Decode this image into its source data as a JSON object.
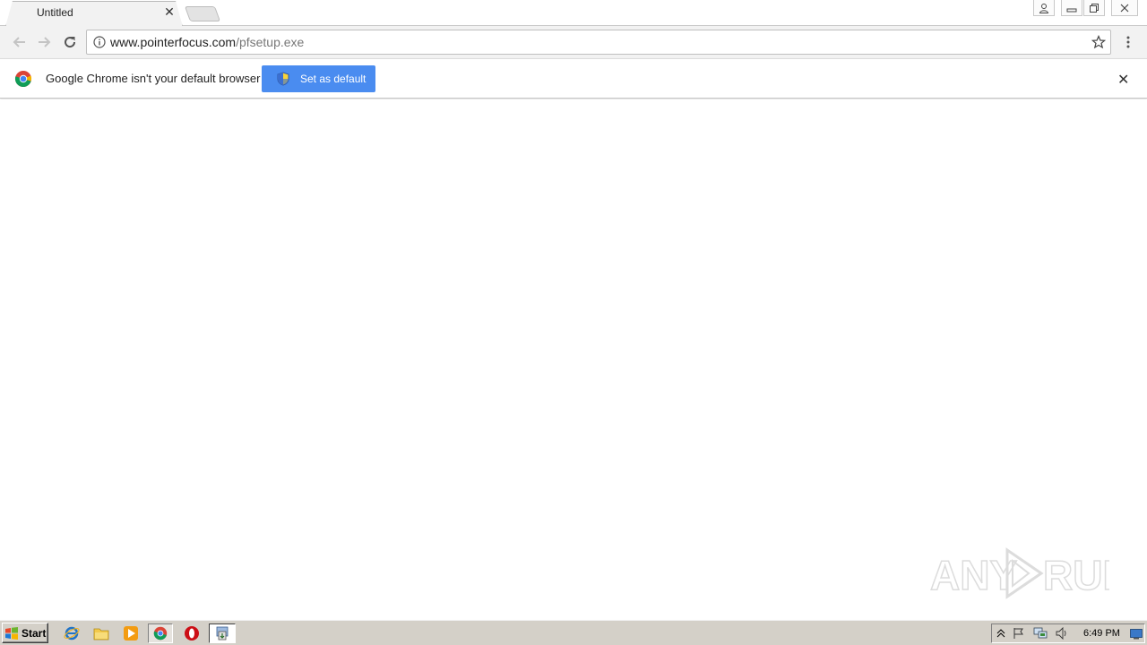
{
  "tab": {
    "title": "Untitled"
  },
  "omnibox": {
    "host": "www.pointerfocus.com",
    "path": "/pfsetup.exe"
  },
  "infobar": {
    "message": "Google Chrome isn't your default browser",
    "button_label": "Set as default"
  },
  "watermark": {
    "text": "ANY RUN"
  },
  "taskbar": {
    "start_label": "Start",
    "clock": "6:49 PM"
  },
  "colors": {
    "accent_button": "#4a8cf0",
    "taskbar": "#d4d0c8"
  }
}
